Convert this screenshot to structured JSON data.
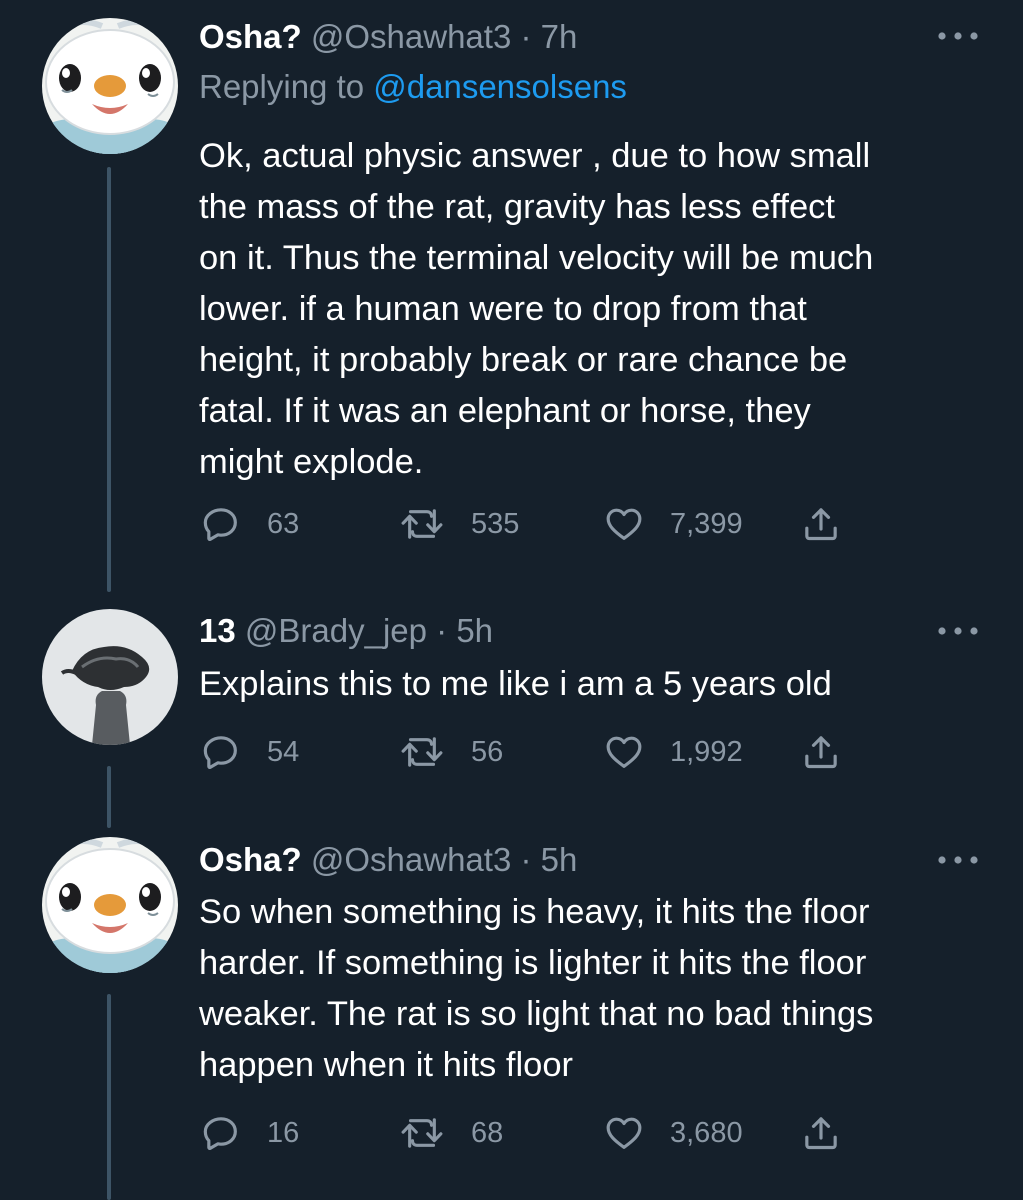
{
  "colors": {
    "background": "#15202b",
    "primary_text": "#ffffff",
    "secondary_text": "#8b98a5",
    "link": "#1d9bf0",
    "thread_line": "#3d5466"
  },
  "tweets": [
    {
      "display_name": "Osha?",
      "handle": "@Oshawhat3",
      "separator": " · ",
      "time": "7h",
      "replying_label": "Replying to ",
      "replying_to": "@dansensolsens",
      "text": "Ok, actual physic answer , due to how small\nthe mass of the rat, gravity has less effect\non it. Thus the terminal velocity will be much\nlower. if a human were to drop from that\nheight, it probably break or rare chance be\nfatal. If it was an elephant or horse, they\nmight explode.",
      "replies": "63",
      "retweets": "535",
      "likes": "7,399",
      "avatar_icon": "oshawott-avatar"
    },
    {
      "display_name": "13",
      "handle": "@Brady_jep",
      "separator": " · ",
      "time": "5h",
      "text": "Explains this to me like i am a 5 years old",
      "replies": "54",
      "retweets": "56",
      "likes": "1,992",
      "avatar_icon": "statue-avatar"
    },
    {
      "display_name": "Osha?",
      "handle": "@Oshawhat3",
      "separator": " · ",
      "time": "5h",
      "text": "So when something is heavy, it hits the floor\nharder. If something is lighter it hits the floor\nweaker. The rat is so light that no bad things\nhappen when it hits floor",
      "replies": "16",
      "retweets": "68",
      "likes": "3,680",
      "avatar_icon": "oshawott-avatar"
    }
  ],
  "icons": {
    "reply": "reply-icon",
    "retweet": "retweet-icon",
    "like": "heart-icon",
    "share": "share-icon",
    "more": "more-icon"
  }
}
